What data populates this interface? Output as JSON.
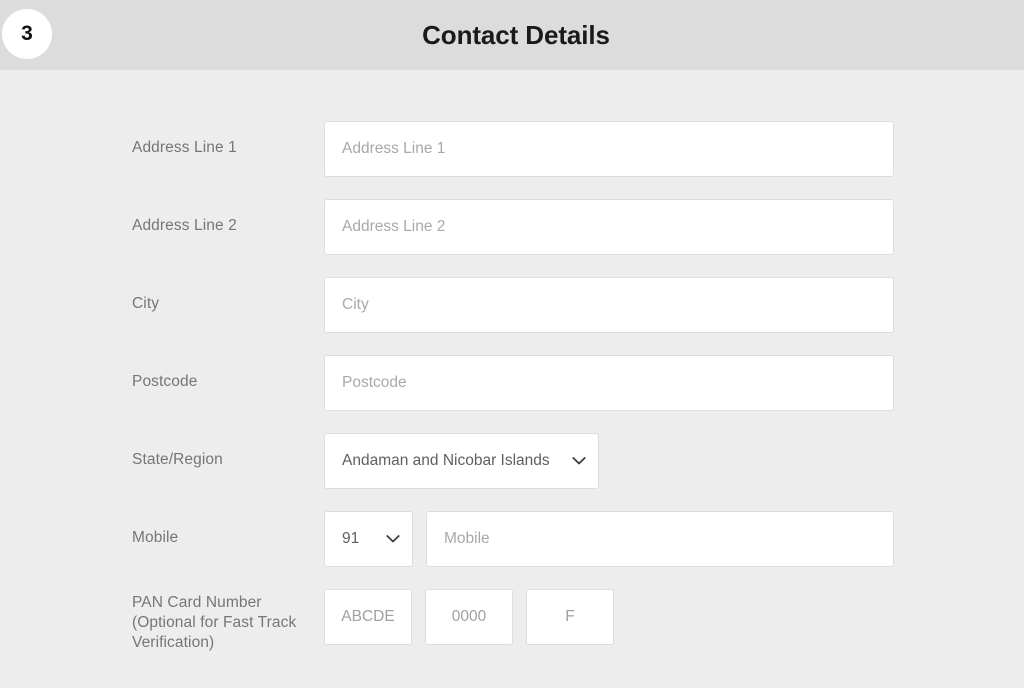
{
  "header": {
    "step_number": "3",
    "title": "Contact Details"
  },
  "colors": {
    "header_bg": "#dcdcdc",
    "page_bg": "#ededed",
    "field_bg": "#ffffff",
    "field_border": "#dddddd",
    "label_text": "#76767a",
    "placeholder_text": "#a8a8ad",
    "title_text": "#1a1a1a"
  },
  "form": {
    "rows": [
      {
        "label": "Address Line 1",
        "name": "address-line-1",
        "placeholder": "Address Line 1"
      },
      {
        "label": "Address Line 2",
        "name": "address-line-2",
        "placeholder": "Address Line 2"
      },
      {
        "label": "City",
        "name": "city",
        "placeholder": "City"
      },
      {
        "label": "Postcode",
        "name": "postcode",
        "placeholder": "Postcode"
      }
    ],
    "state": {
      "label": "State/Region",
      "selected": "Andaman and Nicobar Islands",
      "chevron_icon": "chevron-down-icon"
    },
    "mobile": {
      "label": "Mobile",
      "country_code": "91",
      "country_chevron_icon": "chevron-down-icon",
      "placeholder": "Mobile"
    },
    "pan": {
      "label_line_1": "PAN Card Number",
      "label_line_2": "(Optional for Fast Track",
      "label_line_3": "Verification)",
      "parts": [
        {
          "name": "pan-letters",
          "placeholder": "ABCDE"
        },
        {
          "name": "pan-digits",
          "placeholder": "0000"
        },
        {
          "name": "pan-last-letter",
          "placeholder": "F"
        }
      ]
    }
  }
}
